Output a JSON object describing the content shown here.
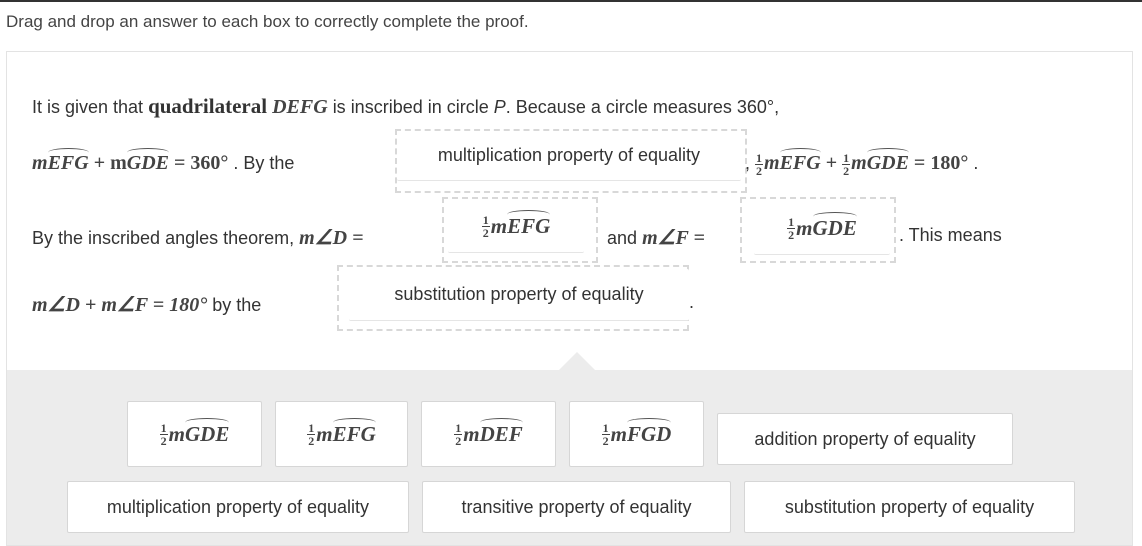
{
  "instruction": "Drag and drop an answer to each box to correctly complete the proof.",
  "proof": {
    "line1_a": "It is given that",
    "line1_b": "quadrilateral",
    "line1_c": "DEFG",
    "line1_d": "is inscribed in circle",
    "line1_e": "P",
    "line1_f": ". Because a circle measures 360°,",
    "line2_eq_a": "m",
    "line2_eq_arc1": "EFG",
    "line2_eq_b": " + m",
    "line2_eq_arc2": "GDE",
    "line2_eq_c": " = 360°",
    "line2_a": ". By the",
    "line2_sep": ",",
    "line2_eq2_a": "m",
    "line2_eq2_arc1": "EFG",
    "line2_eq2_b": " + ",
    "line2_eq2_c": "m",
    "line2_eq2_arc2": "GDE",
    "line2_eq2_d": " = 180°",
    "line2_end": ".",
    "line3_a": "By the inscribed angles theorem,",
    "line3_eq1": "m∠D =",
    "line3_b": "and",
    "line3_eq2": "m∠F =",
    "line3_c": ". This means",
    "line4_eq": "m∠D + m∠F = 180°",
    "line4_a": "by the",
    "line4_end": "."
  },
  "drop_boxes": {
    "box1": "multiplication property of equality",
    "box2_m": "m",
    "box2_arc": "EFG",
    "box3_m": "m",
    "box3_arc": "GDE",
    "box4": "substitution property of equality"
  },
  "fraction": {
    "num": "1",
    "den": "2"
  },
  "answer_bank": {
    "row1": [
      {
        "m": "m",
        "arc": "GDE"
      },
      {
        "m": "m",
        "arc": "EFG"
      },
      {
        "m": "m",
        "arc": "DEF"
      },
      {
        "m": "m",
        "arc": "FGD"
      },
      {
        "text": "addition property of equality"
      }
    ],
    "row2": [
      "multiplication property of equality",
      "transitive property of equality",
      "substitution property of equality"
    ]
  }
}
